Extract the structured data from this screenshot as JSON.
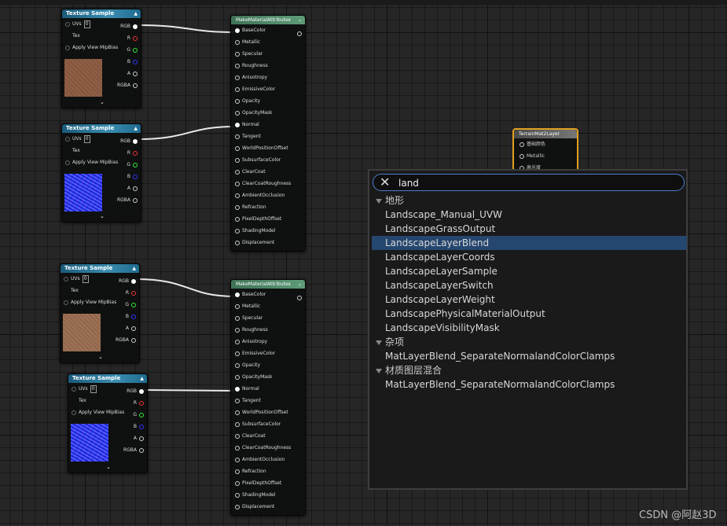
{
  "texture_samples": [
    {
      "title": "Texture Sample",
      "uv_value": "0",
      "inputs": [
        "UVs",
        "Tex",
        "Apply View MipBias"
      ],
      "outputs": [
        "RGB",
        "R",
        "G",
        "B",
        "A",
        "RGBA"
      ],
      "swatch": "brown"
    },
    {
      "title": "Texture Sample",
      "uv_value": "0",
      "inputs": [
        "UVs",
        "Tex",
        "Apply View MipBias"
      ],
      "outputs": [
        "RGB",
        "R",
        "G",
        "B",
        "A",
        "RGBA"
      ],
      "swatch": "blue"
    },
    {
      "title": "Texture Sample",
      "uv_value": "0",
      "inputs": [
        "UVs",
        "Tex",
        "Apply View MipBias"
      ],
      "outputs": [
        "RGB",
        "R",
        "G",
        "B",
        "A",
        "RGBA"
      ],
      "swatch": "brown"
    },
    {
      "title": "Texture Sample",
      "uv_value": "0",
      "inputs": [
        "UVs",
        "Tex",
        "Apply View MipBias"
      ],
      "outputs": [
        "RGB",
        "R",
        "G",
        "B",
        "A",
        "RGBA"
      ],
      "swatch": "blue"
    }
  ],
  "make_material_attributes": {
    "title": "MakeMaterialAttributes",
    "pins": [
      "BaseColor",
      "Metallic",
      "Specular",
      "Roughness",
      "Anisotropy",
      "EmissiveColor",
      "Opacity",
      "OpacityMask",
      "Normal",
      "Tangent",
      "WorldPositionOffset",
      "SubsurfaceColor",
      "ClearCoat",
      "ClearCoatRoughness",
      "AmbientOcclusion",
      "Refraction",
      "PixelDepthOffset",
      "ShadingModel",
      "Displacement"
    ]
  },
  "terrain_node": {
    "title": "TerrainMat2Layer",
    "pins": [
      "基础颜色",
      "Metallic",
      "高光度"
    ]
  },
  "search_menu": {
    "query": "land",
    "categories": [
      {
        "name": "地形",
        "items": [
          "Landscape_Manual_UVW",
          "LandscapeGrassOutput",
          "LandscapeLayerBlend",
          "LandscapeLayerCoords",
          "LandscapeLayerSample",
          "LandscapeLayerSwitch",
          "LandscapeLayerWeight",
          "LandscapePhysicalMaterialOutput",
          "LandscapeVisibilityMask"
        ]
      },
      {
        "name": "杂项",
        "items": [
          "MatLayerBlend_SeparateNormalandColorClamps"
        ]
      },
      {
        "name": "材质图层混合",
        "items": [
          "MatLayerBlend_SeparateNormalandColorClamps"
        ]
      }
    ],
    "selected": "LandscapeLayerBlend"
  },
  "watermark": "CSDN @阿赵3D",
  "colors": {
    "selection": "#25466e",
    "search_border": "#4b7fcf",
    "terrain_border": "#e0a020"
  }
}
